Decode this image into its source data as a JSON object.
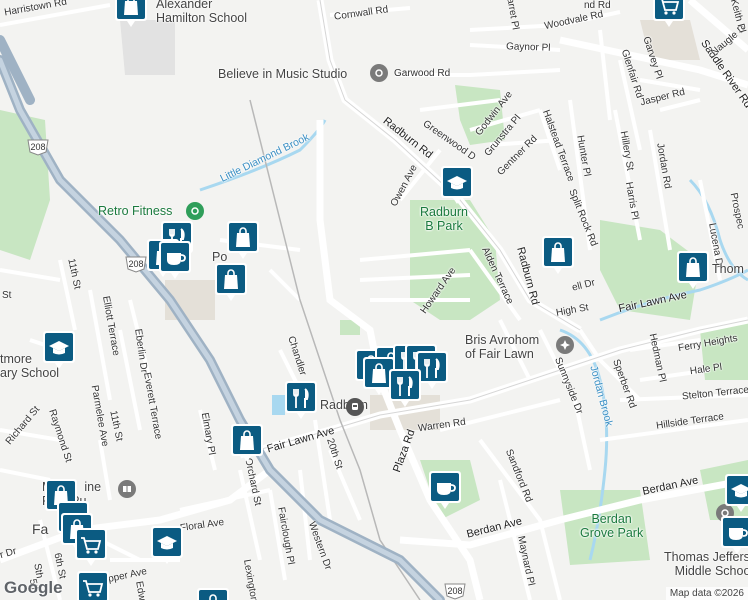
{
  "attribution": {
    "logo": "Google",
    "credit": "Map data ©2026"
  },
  "colors": {
    "background": "#f3f3f1",
    "park": "#c8e6c2",
    "water": "#a8d8f0",
    "highway": "#90a4b8",
    "pin": "#0b5b82"
  },
  "pois": {
    "music_studio": "Believe in Music Studio",
    "school_alexander": "Alexander\nHamilton School",
    "retro_fitness": "Retro Fitness",
    "radburn_park": "Radburn\nB Park",
    "bris_avrohom": "Bris Avrohom\nof Fair Lawn",
    "berdan_grove": "Berdan\nGrove Park",
    "jefferson_school": "Thomas Jefferson\nMiddle School",
    "radburn_station": "Radburn",
    "maurice_library": "Maur    ine\nFree Pu",
    "westmoreland": "tmore\nary School",
    "thom": "Thom",
    "fa": "Fa",
    "po": "Po"
  },
  "water": {
    "little_diamond": "Little Diamond Brook",
    "jordan_brook": "Jordan Brook"
  },
  "roads": {
    "harristown": "Harristown Rd",
    "cornwall": "Cornwall Rd",
    "woodvale": "Woodvale Rd",
    "gaynor": "Gaynor Pl",
    "garwood": "Garwood Rd",
    "radburn_rd_upper": "Radburn Rd",
    "radburn_rd_right": "Radburn Rd",
    "greenwood": "Greenwood D",
    "godwin": "Godwin Ave",
    "grunstra": "Grunstra Pl",
    "gentner": "Gentner Rd",
    "halstead": "Halstead Terrace",
    "hunter": "Hunter Pl",
    "hillery": "Hillery St",
    "harris": "Harris Pl",
    "jordan_rd": "Jordan Rd",
    "split_rock": "Split Rock Rd",
    "owen": "Owen Ave",
    "howard": "Howard Ave",
    "alden": "Alden Terrace",
    "high": "High St",
    "fair_lawn_right": "Fair Lawn Ave",
    "fair_lawn_left": "Fair Lawn Ave",
    "ferry_heights": "Ferry Heights",
    "hale": "Hale Pl",
    "stelton": "Stelton Terrace",
    "hillside": "Hillside Terrace",
    "hedman": "Hedman Pl",
    "sperber": "Sperber Rd",
    "sumnyside": "Sunnyside Dr",
    "warren": "Warren Rd",
    "plaza": "Plaza Rd",
    "sandford": "Sandford Rd",
    "berdan": "Berdan Ave",
    "berdan_left": "Berdan Ave",
    "maynard": "Maynard Pl",
    "chandler": "Chandler",
    "twentieth": "20th St",
    "elmary": "Elmary Pl",
    "orchard": "Orchard St",
    "fairclough": "Fairclough Pl",
    "western": "Western Dr",
    "lexington": "Lexington",
    "floral": "Floral Ave",
    "everett": "Everett Terrace",
    "elliott": "Elliott Terrace",
    "eberlin": "Eberlin Dr",
    "eleventh_a": "11th St",
    "eleventh_b": "11th St",
    "parmelee": "Parmelee Ave",
    "raymond": "Raymond St",
    "richard": "Richard St",
    "sixth": "6th St",
    "fifth": "5th",
    "pepper": "pper Ave",
    "edw": "Edw",
    "saddle_river": "Saddle River Rd",
    "jasper": "Jasper Rd",
    "glenfair": "Glenfair Rd",
    "garvey": "Garvey Pl",
    "naugle": "Naugle D",
    "keith": "Keith Pl",
    "prospect": "Prospec",
    "lucena": "Lucena Dr",
    "well": "ell Dr",
    "st": "St",
    "garret": "arret Pl",
    "nd": "nd Rd",
    "r_dr": "r Dr",
    "sth": "Sth"
  },
  "highway_shields": [
    "208",
    "208",
    "208"
  ],
  "icons": {
    "shopping": "shopping-bag-icon",
    "school": "school-cap-icon",
    "restaurant": "fork-knife-icon",
    "cafe": "coffee-cup-icon",
    "cart": "shopping-cart-icon",
    "train": "train-icon",
    "religious": "religious-place-icon",
    "book": "library-book-icon",
    "landmark": "place-dot-icon"
  }
}
